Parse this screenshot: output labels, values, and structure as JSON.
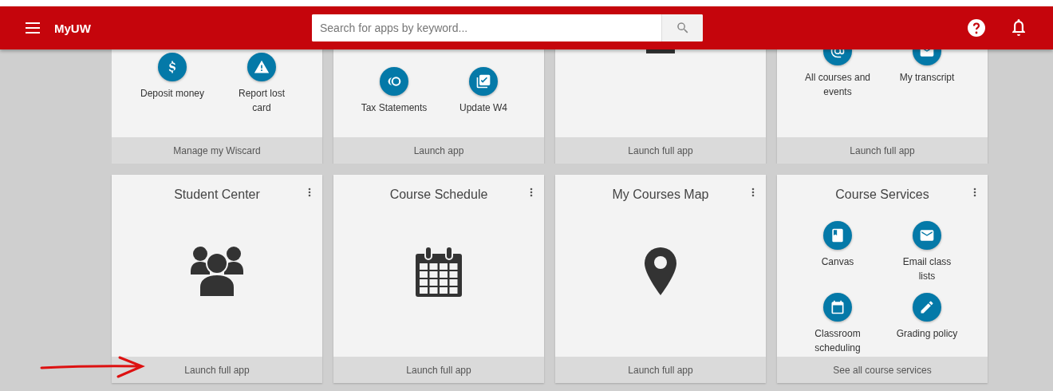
{
  "header": {
    "title": "MyUW",
    "search": {
      "placeholder": "Search for apps by keyword..."
    }
  },
  "top_cards": [
    {
      "items": [
        {
          "label": "Deposit money"
        },
        {
          "label": "Report lost card"
        }
      ],
      "footer": "Manage my Wiscard"
    },
    {
      "items": [
        {
          "label": "Tax Statements"
        },
        {
          "label": "Update W4"
        }
      ],
      "footer": "Launch app"
    },
    {
      "footer": "Launch full app"
    },
    {
      "items": [
        {
          "label": "All courses and events"
        },
        {
          "label": "My transcript"
        }
      ],
      "footer": "Launch full app"
    }
  ],
  "cards": [
    {
      "title": "Student Center",
      "footer": "Launch full app"
    },
    {
      "title": "Course Schedule",
      "footer": "Launch full app"
    },
    {
      "title": "My Courses Map",
      "footer": "Launch full app"
    },
    {
      "title": "Course Services",
      "items": [
        {
          "label": "Canvas"
        },
        {
          "label": "Email class lists"
        },
        {
          "label": "Classroom scheduling"
        },
        {
          "label": "Grading policy"
        }
      ],
      "footer": "See all course services"
    }
  ]
}
